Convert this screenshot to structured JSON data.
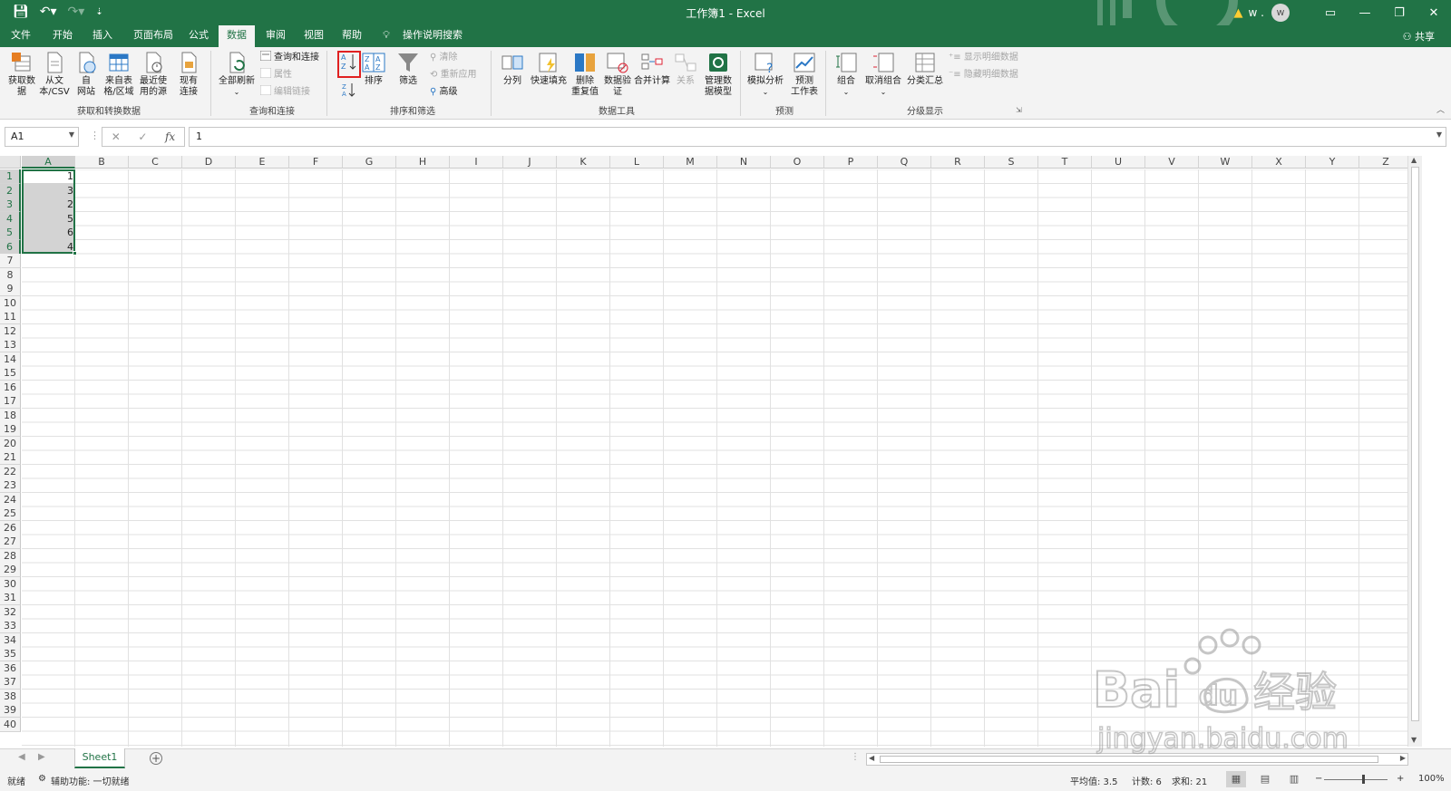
{
  "titlebar": {
    "title": "工作簿1  -  Excel",
    "user_name": "w .",
    "avatar_initial": "w",
    "warning_icon": "warning-icon"
  },
  "tabs": [
    {
      "label": "文件"
    },
    {
      "label": "开始"
    },
    {
      "label": "插入"
    },
    {
      "label": "页面布局"
    },
    {
      "label": "公式"
    },
    {
      "label": "数据",
      "active": true
    },
    {
      "label": "审阅"
    },
    {
      "label": "视图"
    },
    {
      "label": "帮助"
    },
    {
      "label": "操作说明搜索"
    }
  ],
  "share_label": "共享",
  "ribbon": {
    "get_data": "获取数\n据",
    "from_text": "从文\n本/CSV",
    "from_web": "自\n网站",
    "from_table": "来自表\n格/区域",
    "recent_sources": "最近使\n用的源",
    "existing_connections": "现有\n连接",
    "group_get_transform": "获取和转换数据",
    "refresh_all": "全部刷新",
    "queries_connections": "查询和连接",
    "properties": "属性",
    "edit_links": "编辑链接",
    "group_queries": "查询和连接",
    "sort": "排序",
    "filter": "筛选",
    "clear": "清除",
    "reapply": "重新应用",
    "advanced": "高级",
    "group_sort_filter": "排序和筛选",
    "text_to_columns": "分列",
    "flash_fill": "快速填充",
    "remove_duplicates": "删除\n重复值",
    "data_validation": "数据验\n证",
    "consolidate": "合并计算",
    "relationships": "关系",
    "manage_data_model": "管理数\n据模型",
    "group_data_tools": "数据工具",
    "what_if": "模拟分析",
    "forecast_sheet": "预测\n工作表",
    "group_forecast": "预测",
    "group_btn": "组合",
    "ungroup": "取消组合",
    "subtotal": "分类汇总",
    "show_detail": "显示明细数据",
    "hide_detail": "隐藏明细数据",
    "group_outline": "分级显示"
  },
  "formula_bar": {
    "name_box": "A1",
    "formula": "1"
  },
  "columns": [
    "A",
    "B",
    "C",
    "D",
    "E",
    "F",
    "G",
    "H",
    "I",
    "J",
    "K",
    "L",
    "M",
    "N",
    "O",
    "P",
    "Q",
    "R",
    "S",
    "T",
    "U",
    "V",
    "W",
    "X",
    "Y",
    "Z"
  ],
  "rows": [
    "1",
    "2",
    "3",
    "4",
    "5",
    "6",
    "7",
    "8",
    "9",
    "10",
    "11",
    "12",
    "13",
    "14",
    "15",
    "16",
    "17",
    "18",
    "19",
    "20",
    "21",
    "22",
    "23",
    "24",
    "25",
    "26",
    "27",
    "28",
    "29",
    "30",
    "31",
    "32",
    "33",
    "34",
    "35",
    "36",
    "37",
    "38",
    "39",
    "40"
  ],
  "cells_A": [
    "1",
    "3",
    "2",
    "5",
    "6",
    "4"
  ],
  "sheet_tab": "Sheet1",
  "status": {
    "ready": "就绪",
    "accessibility": "辅助功能: 一切就绪",
    "average": "平均值: 3.5",
    "count": "计数: 6",
    "sum": "求和: 21",
    "zoom": "100%"
  },
  "watermark": {
    "brand": "Bai",
    "brand2": "du",
    "brand3": "经验",
    "url": "jingyan.baidu.com"
  },
  "colors": {
    "excel_green": "#217346",
    "highlight_red": "#e02020"
  }
}
